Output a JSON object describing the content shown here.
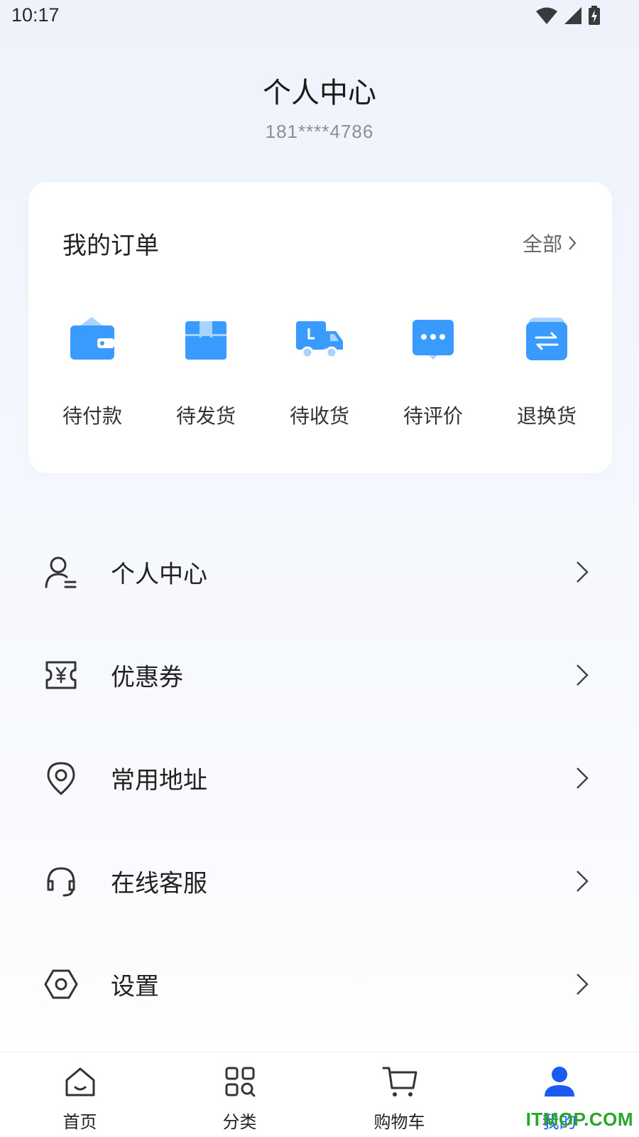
{
  "status_bar": {
    "time": "10:17"
  },
  "header": {
    "title": "个人中心",
    "phone": "181****4786"
  },
  "orders": {
    "title": "我的订单",
    "all_label": "全部",
    "items": [
      {
        "label": "待付款",
        "icon": "wallet-icon"
      },
      {
        "label": "待发货",
        "icon": "package-icon"
      },
      {
        "label": "待收货",
        "icon": "truck-icon"
      },
      {
        "label": "待评价",
        "icon": "chat-icon"
      },
      {
        "label": "退换货",
        "icon": "exchange-icon"
      }
    ],
    "accent_color": "#3a9bff"
  },
  "menu": {
    "items": [
      {
        "label": "个人中心",
        "icon": "user-icon"
      },
      {
        "label": "优惠券",
        "icon": "coupon-icon"
      },
      {
        "label": "常用地址",
        "icon": "location-icon"
      },
      {
        "label": "在线客服",
        "icon": "headset-icon"
      },
      {
        "label": "设置",
        "icon": "settings-icon"
      }
    ]
  },
  "tabbar": {
    "tabs": [
      {
        "label": "首页",
        "icon": "home-icon"
      },
      {
        "label": "分类",
        "icon": "category-icon"
      },
      {
        "label": "购物车",
        "icon": "cart-icon"
      },
      {
        "label": "我的",
        "icon": "profile-icon",
        "active": true
      }
    ],
    "active_color": "#1a5cf0"
  },
  "watermark": "ITMOP.COM"
}
